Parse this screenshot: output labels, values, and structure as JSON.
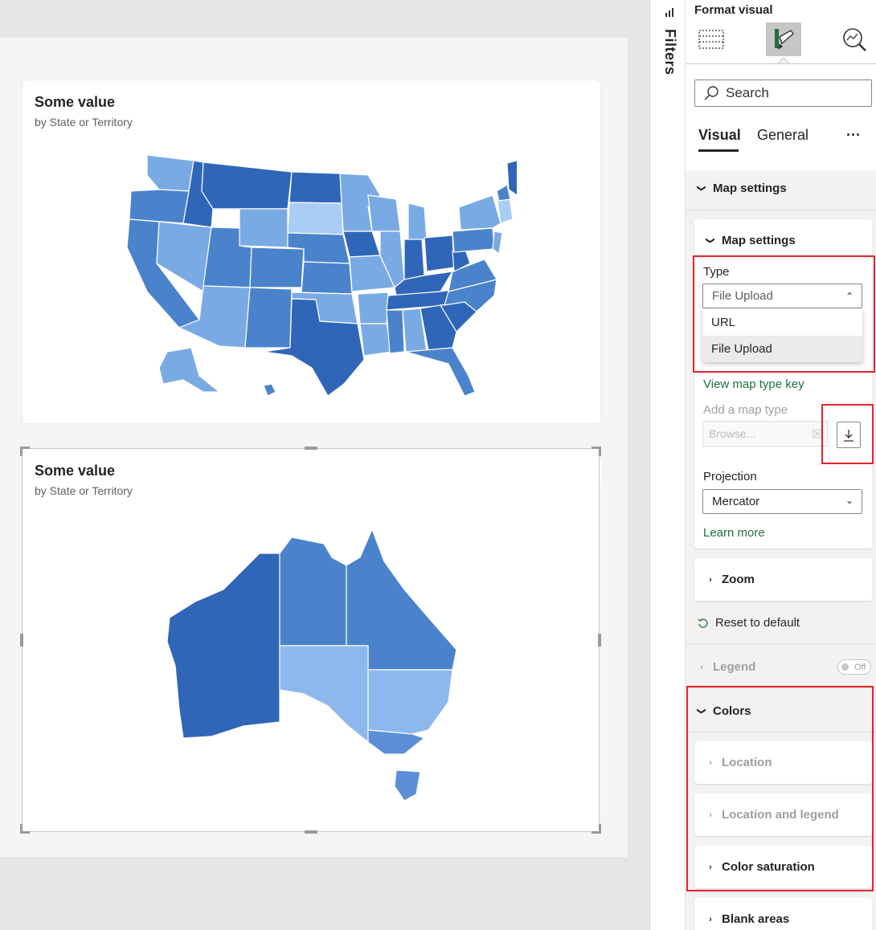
{
  "visuals": [
    {
      "title": "Some value",
      "subtitle": "by State or Territory"
    },
    {
      "title": "Some value",
      "subtitle": "by State or Territory"
    }
  ],
  "visual_header_icons": [
    "pin-icon",
    "copilot-icon",
    "filter-icon",
    "focus-mode-icon",
    "more-options-icon"
  ],
  "filters": {
    "label": "Filters"
  },
  "format_pane": {
    "title": "Format visual",
    "search_placeholder": "Search",
    "tabs": [
      "Visual",
      "General"
    ],
    "more": "···",
    "map_settings_group": "Map settings",
    "map_settings_card": {
      "title": "Map settings",
      "type_label": "Type",
      "type_value": "File Upload",
      "type_options": [
        "URL",
        "File Upload"
      ],
      "type_key_link": "View map type key",
      "add_map_type_label": "Add a map type",
      "browse_placeholder": "Browse...",
      "projection_label": "Projection",
      "projection_value": "Mercator",
      "learn_more": "Learn more"
    },
    "zoom": "Zoom",
    "reset": "Reset to default",
    "legend": {
      "label": "Legend",
      "toggle": "Off"
    },
    "colors": {
      "title": "Colors",
      "location": "Location",
      "location_and_legend": "Location and legend",
      "color_saturation": "Color saturation"
    },
    "blank_areas": "Blank areas"
  },
  "colors": {
    "dark": "#2f66b8",
    "mid": "#4a83cc",
    "light": "#7aaae4",
    "pale": "#aacdf5",
    "highlight": "#e3242b",
    "link": "#1f6e43"
  }
}
